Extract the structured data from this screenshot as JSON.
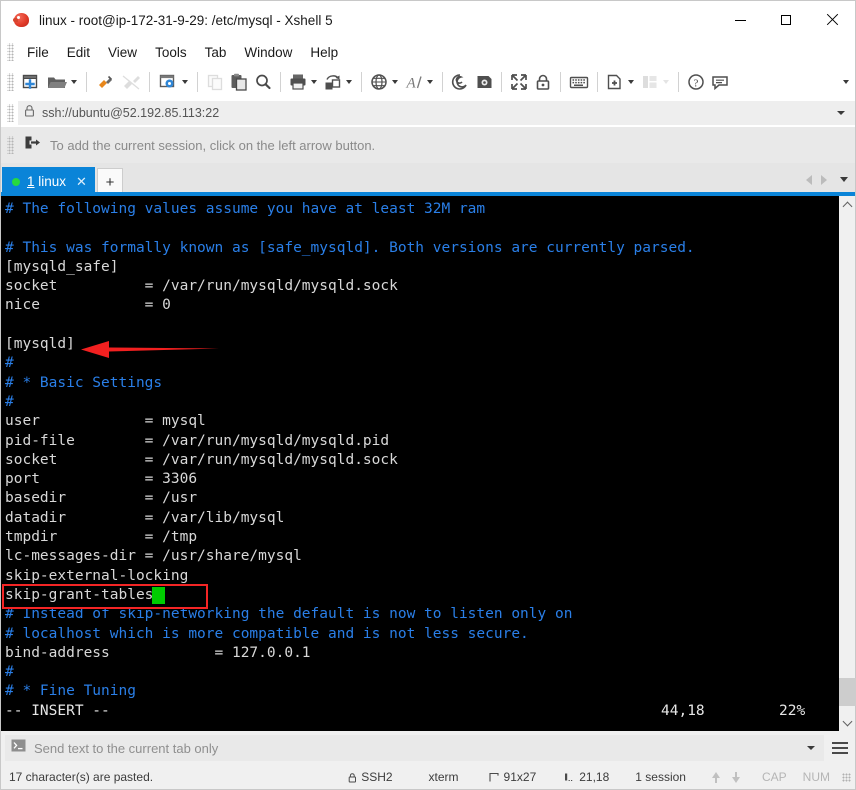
{
  "window": {
    "title": "linux - root@ip-172-31-9-29: /etc/mysql - Xshell 5",
    "app_icon": "xshell-icon",
    "minimize_label": "—",
    "maximize_label": "□",
    "close_label": "✕"
  },
  "menubar": {
    "items": [
      {
        "label": "File"
      },
      {
        "label": "Edit"
      },
      {
        "label": "View"
      },
      {
        "label": "Tools"
      },
      {
        "label": "Tab"
      },
      {
        "label": "Window"
      },
      {
        "label": "Help"
      }
    ]
  },
  "toolbar": {
    "buttons": [
      {
        "name": "new-session-icon",
        "title": "New"
      },
      {
        "name": "open-folder-icon",
        "title": "Open"
      },
      {
        "name": "connect-icon",
        "title": "Connect"
      },
      {
        "name": "disconnect-icon",
        "title": "Disconnect"
      },
      {
        "name": "session-properties-icon",
        "title": "Properties"
      },
      {
        "name": "copy-icon",
        "title": "Copy"
      },
      {
        "name": "paste-icon",
        "title": "Paste"
      },
      {
        "name": "find-icon",
        "title": "Find"
      },
      {
        "name": "print-icon",
        "title": "Print"
      },
      {
        "name": "transfer-file-icon",
        "title": "File Transfer"
      },
      {
        "name": "globe-icon",
        "title": "Web"
      },
      {
        "name": "font-icon",
        "title": "Font"
      },
      {
        "name": "log-icon",
        "title": "Log"
      },
      {
        "name": "compose-icon",
        "title": "Compose"
      },
      {
        "name": "fullscreen-icon",
        "title": "Full Screen"
      },
      {
        "name": "lock-icon",
        "title": "Lock"
      },
      {
        "name": "keyboard-icon",
        "title": "Keyboard"
      },
      {
        "name": "add-tab-icon",
        "title": "New Tab"
      },
      {
        "name": "layout-icon",
        "title": "Arrange"
      },
      {
        "name": "help-icon",
        "title": "Help"
      },
      {
        "name": "feedback-icon",
        "title": "Feedback"
      }
    ]
  },
  "address_bar": {
    "icon": "lock-icon",
    "value": "ssh://ubuntu@52.192.85.113:22",
    "dropdown_icon": "chevron-down-icon"
  },
  "notice_bar": {
    "icon": "add-session-icon",
    "text": "To add the current session, click on the left arrow button."
  },
  "tab_bar": {
    "tabs": [
      {
        "index": "1",
        "label": "linux",
        "status": "connected",
        "close_icon": "close-icon"
      }
    ],
    "new_tab_label": "+",
    "scroll_left_icon": "triangle-left-icon",
    "scroll_right_icon": "triangle-right-icon",
    "tab_list_icon": "chevron-down-icon"
  },
  "terminal": {
    "lines": [
      {
        "text": "# The following values assume you have at least 32M ram",
        "comment": true
      },
      {
        "text": "",
        "comment": false
      },
      {
        "text": "# This was formally known as [safe_mysqld]. Both versions are currently parsed.",
        "comment": true
      },
      {
        "text": "[mysqld_safe]",
        "comment": false
      },
      {
        "text": "socket          = /var/run/mysqld/mysqld.sock",
        "comment": false
      },
      {
        "text": "nice            = 0",
        "comment": false
      },
      {
        "text": "",
        "comment": false
      },
      {
        "text": "[mysqld]",
        "comment": false
      },
      {
        "text": "#",
        "comment": true
      },
      {
        "text": "# * Basic Settings",
        "comment": true
      },
      {
        "text": "#",
        "comment": true
      },
      {
        "text": "user            = mysql",
        "comment": false
      },
      {
        "text": "pid-file        = /var/run/mysqld/mysqld.pid",
        "comment": false
      },
      {
        "text": "socket          = /var/run/mysqld/mysqld.sock",
        "comment": false
      },
      {
        "text": "port            = 3306",
        "comment": false
      },
      {
        "text": "basedir         = /usr",
        "comment": false
      },
      {
        "text": "datadir         = /var/lib/mysql",
        "comment": false
      },
      {
        "text": "tmpdir          = /tmp",
        "comment": false
      },
      {
        "text": "lc-messages-dir = /usr/share/mysql",
        "comment": false
      },
      {
        "text": "skip-external-locking",
        "comment": false
      },
      {
        "text": "skip-grant-tables",
        "comment": false
      },
      {
        "text": "# Instead of skip-networking the default is now to listen only on",
        "comment": true
      },
      {
        "text": "# localhost which is more compatible and is not less secure.",
        "comment": true
      },
      {
        "text": "bind-address            = 127.0.0.1",
        "comment": false
      },
      {
        "text": "#",
        "comment": true
      },
      {
        "text": "# * Fine Tuning",
        "comment": true
      }
    ],
    "status_mode": "-- INSERT --",
    "status_position": "44,18",
    "status_percent": "22%",
    "cursor": "block-cursor",
    "annotations": {
      "highlight_box": "red-rectangle-highlight",
      "pointer": "red-arrow-annotation"
    },
    "colors": {
      "background": "#000000",
      "foreground": "#d8d8d8",
      "comment": "#2a7fe8",
      "cursor": "#00cc00",
      "annotation": "#f42525"
    },
    "scrollbar": {
      "up_icon": "chevron-up-icon",
      "down_icon": "chevron-down-icon"
    }
  },
  "send_bar": {
    "icon": "command-prompt-icon",
    "placeholder": "Send text to the current tab only",
    "value": "",
    "dropdown_icon": "chevron-down-icon",
    "menu_icon": "hamburger-menu-icon"
  },
  "status_bar": {
    "message": "17 character(s) are pasted.",
    "protocol_icon": "lock-icon",
    "protocol": "SSH2",
    "terminal_type": "xterm",
    "size_icon": "screen-size-icon",
    "size": "91x27",
    "cursor_icon": "cursor-position-icon",
    "cursor_position": "21,18",
    "sessions": "1 session",
    "upload_icon": "arrow-up-icon",
    "download_icon": "arrow-down-icon",
    "caps_lock": "CAP",
    "num_lock": "NUM",
    "resize_grip": "resize-grip-icon"
  }
}
